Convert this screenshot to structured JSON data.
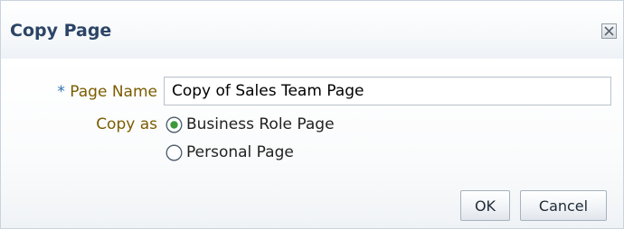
{
  "dialog": {
    "title": "Copy Page",
    "close_icon": "close-icon"
  },
  "form": {
    "page_name": {
      "required_marker": "*",
      "label": "Page Name",
      "value": "Copy of Sales Team Page"
    },
    "copy_as": {
      "label": "Copy as",
      "options": [
        {
          "label": "Business Role Page",
          "selected": true
        },
        {
          "label": "Personal Page",
          "selected": false
        }
      ]
    }
  },
  "buttons": {
    "ok_label": "OK",
    "cancel_label": "Cancel"
  },
  "colors": {
    "title": "#2c4466",
    "label": "#7b5c00",
    "required": "#2d6fb4",
    "radio_selected": "#3c9a3c"
  }
}
